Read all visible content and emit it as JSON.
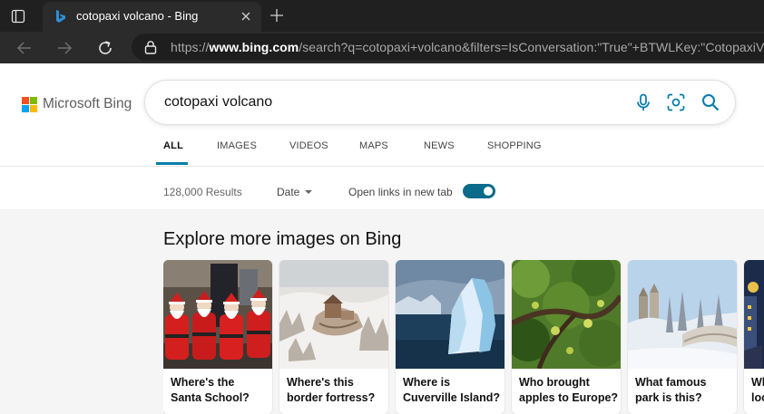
{
  "browser": {
    "tab_title": "cotopaxi volcano - Bing",
    "url_prefix": "https://",
    "url_host": "www.bing.com",
    "url_path": "/search?q=cotopaxi+volcano&filters=IsConversation:\"True\"+BTWLKey:\"CotopaxiVolc"
  },
  "bing": {
    "logo_text": "Microsoft Bing",
    "query": "cotopaxi volcano",
    "tabs": [
      {
        "label": "ALL",
        "active": true
      },
      {
        "label": "IMAGES"
      },
      {
        "label": "VIDEOS"
      },
      {
        "label": "MAPS"
      },
      {
        "label": "NEWS"
      },
      {
        "label": "SHOPPING"
      }
    ],
    "result_count": "128,000 Results",
    "date_filter": "Date",
    "open_links_label": "Open links in new tab",
    "open_links_enabled": true
  },
  "explore": {
    "title": "Explore more images on Bing",
    "cards": [
      {
        "line1": "Where's the",
        "line2": "Santa School?",
        "image": "santas-photo"
      },
      {
        "line1": "Where's this",
        "line2": "border fortress?",
        "image": "snowy-fortress-photo"
      },
      {
        "line1": "Where is",
        "line2": "Cuverville Island?",
        "image": "iceberg-photo"
      },
      {
        "line1": "Who brought",
        "line2": "apples to Europe?",
        "image": "apple-tree-photo"
      },
      {
        "line1": "What famous",
        "line2": "park is this?",
        "image": "snowy-park-photo"
      },
      {
        "line1": "Wh",
        "line2": "loc",
        "image": "city-lights-photo"
      }
    ]
  },
  "colors": {
    "accent": "#007daa",
    "toggle": "#0b6b8a",
    "logo_red": "#f25022",
    "logo_green": "#7fba00",
    "logo_blue": "#00a4ef",
    "logo_yellow": "#ffb900"
  }
}
